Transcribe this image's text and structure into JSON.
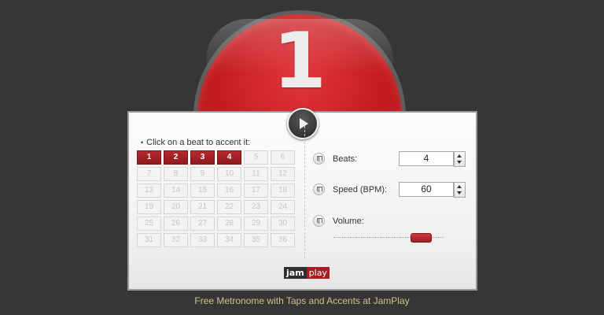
{
  "metronome": {
    "current_beat": "1",
    "play_icon": "play-icon"
  },
  "beat_panel": {
    "instruction": "Click on a beat to accent it:",
    "beats": [
      {
        "label": "1",
        "accented": true
      },
      {
        "label": "2",
        "accented": true
      },
      {
        "label": "3",
        "accented": true
      },
      {
        "label": "4",
        "accented": true
      },
      {
        "label": "5",
        "accented": false
      },
      {
        "label": "6",
        "accented": false
      },
      {
        "label": "7",
        "accented": false
      },
      {
        "label": "8",
        "accented": false
      },
      {
        "label": "9",
        "accented": false
      },
      {
        "label": "10",
        "accented": false
      },
      {
        "label": "11",
        "accented": false
      },
      {
        "label": "12",
        "accented": false
      },
      {
        "label": "13",
        "accented": false
      },
      {
        "label": "14",
        "accented": false
      },
      {
        "label": "15",
        "accented": false
      },
      {
        "label": "16",
        "accented": false
      },
      {
        "label": "17",
        "accented": false
      },
      {
        "label": "18",
        "accented": false
      },
      {
        "label": "19",
        "accented": false
      },
      {
        "label": "20",
        "accented": false
      },
      {
        "label": "21",
        "accented": false
      },
      {
        "label": "22",
        "accented": false
      },
      {
        "label": "23",
        "accented": false
      },
      {
        "label": "24",
        "accented": false
      },
      {
        "label": "25",
        "accented": false
      },
      {
        "label": "26",
        "accented": false
      },
      {
        "label": "27",
        "accented": false
      },
      {
        "label": "28",
        "accented": false
      },
      {
        "label": "29",
        "accented": false
      },
      {
        "label": "30",
        "accented": false
      },
      {
        "label": "31",
        "accented": false
      },
      {
        "label": "32",
        "accented": false
      },
      {
        "label": "33",
        "accented": false
      },
      {
        "label": "34",
        "accented": false
      },
      {
        "label": "35",
        "accented": false
      },
      {
        "label": "36",
        "accented": false
      }
    ]
  },
  "controls": {
    "beats": {
      "label": "Beats:",
      "value": "4",
      "icon": "tuning-fork-icon"
    },
    "speed": {
      "label": "Speed (BPM):",
      "value": "60",
      "icon": "tuning-fork-icon"
    },
    "volume": {
      "label": "Volume:",
      "icon": "tuning-fork-icon",
      "level": 0.85
    }
  },
  "logo": {
    "part1": "jam",
    "part2": "play"
  },
  "footer": {
    "text": "Free Metronome with Taps and Accents at JamPlay"
  },
  "colors": {
    "background": "#363636",
    "accent_red": "#c41d22",
    "footer_text": "#cfc08a"
  }
}
